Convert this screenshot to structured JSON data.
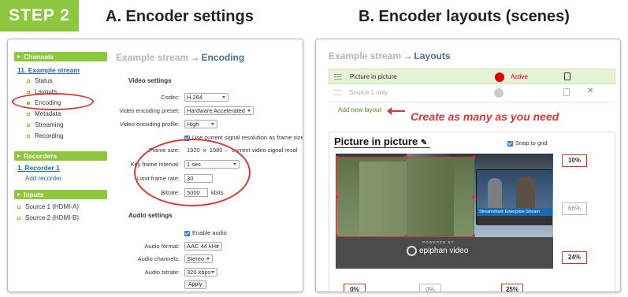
{
  "step_label": "STEP 2",
  "section_a_title": "A. Encoder settings",
  "section_b_title": "B. Encoder layouts (scenes)",
  "encoder": {
    "sidebar": {
      "channels_header": "Channels",
      "channel_name": "11. Example stream",
      "items": [
        "Status",
        "Layouts",
        "Encoding",
        "Metadata",
        "Streaming",
        "Recording"
      ],
      "recorders_header": "Recorders",
      "recorder_name": "1. Recorder 1",
      "add_recorder": "Add recorder",
      "inputs_header": "Inputs",
      "inputs": [
        "Source 1 (HDMI-A)",
        "Source 2 (HDMI-B)"
      ]
    },
    "breadcrumb_stream": "Example stream",
    "breadcrumb_arrow": "→",
    "breadcrumb_page": "Encoding",
    "video_settings_title": "Video settings",
    "codec_label": "Codec:",
    "codec_value": "H.264",
    "preset_label": "Video encoding preset:",
    "preset_value": "Hardware Accelerated",
    "profile_label": "Video encoding profile:",
    "profile_value": "High",
    "use_current_res": "Use current signal resolution as frame size",
    "frame_size_label": "Frame size:",
    "frame_w": "1920",
    "frame_x": "x",
    "frame_h": "1080",
    "frame_note": "← current video signal resol",
    "keyframe_label": "Key frame interval:",
    "keyframe_value": "1 sec",
    "limit_rate_label": "Limit frame rate:",
    "limit_rate_value": "30",
    "bitrate_label": "Bitrate:",
    "bitrate_value": "5000",
    "bitrate_unit": "kbits",
    "audio_settings_title": "Audio settings",
    "enable_audio": "Enable audio",
    "audio_format_label": "Audio format:",
    "audio_format_value": "AAC 44 kHz",
    "audio_channels_label": "Audio channels:",
    "audio_channels_value": "Stereo",
    "audio_bitrate_label": "Audio bitrate:",
    "audio_bitrate_value": "320 kbps",
    "apply_label": "Apply"
  },
  "layouts": {
    "breadcrumb_stream": "Example stream",
    "breadcrumb_arrow": "→",
    "breadcrumb_page": "Layouts",
    "rows": [
      {
        "name": "Picture in picture",
        "status": "Active"
      },
      {
        "name": "Source 1 only",
        "status": ""
      }
    ],
    "add_new_layout": "Add new layout",
    "callout": "Create as many as you need",
    "editor_title": "Picture in picture",
    "snap_to_grid": "Snap to grid",
    "pct_top": "10%",
    "pct_mid": "66%",
    "pct_lower": "24%",
    "pct_bottom_left": "0%",
    "pct_bottom_mid": "0%",
    "pct_bottom_right": "25%",
    "banner_text": "Streamshark Enterprise Stream",
    "logo_small": "POWERED BY",
    "logo_text": "epiphan video"
  },
  "colors": {
    "green": "#8dc63f",
    "red": "#c0392b",
    "blue": "#2b62a4",
    "active_red": "#e00000"
  }
}
